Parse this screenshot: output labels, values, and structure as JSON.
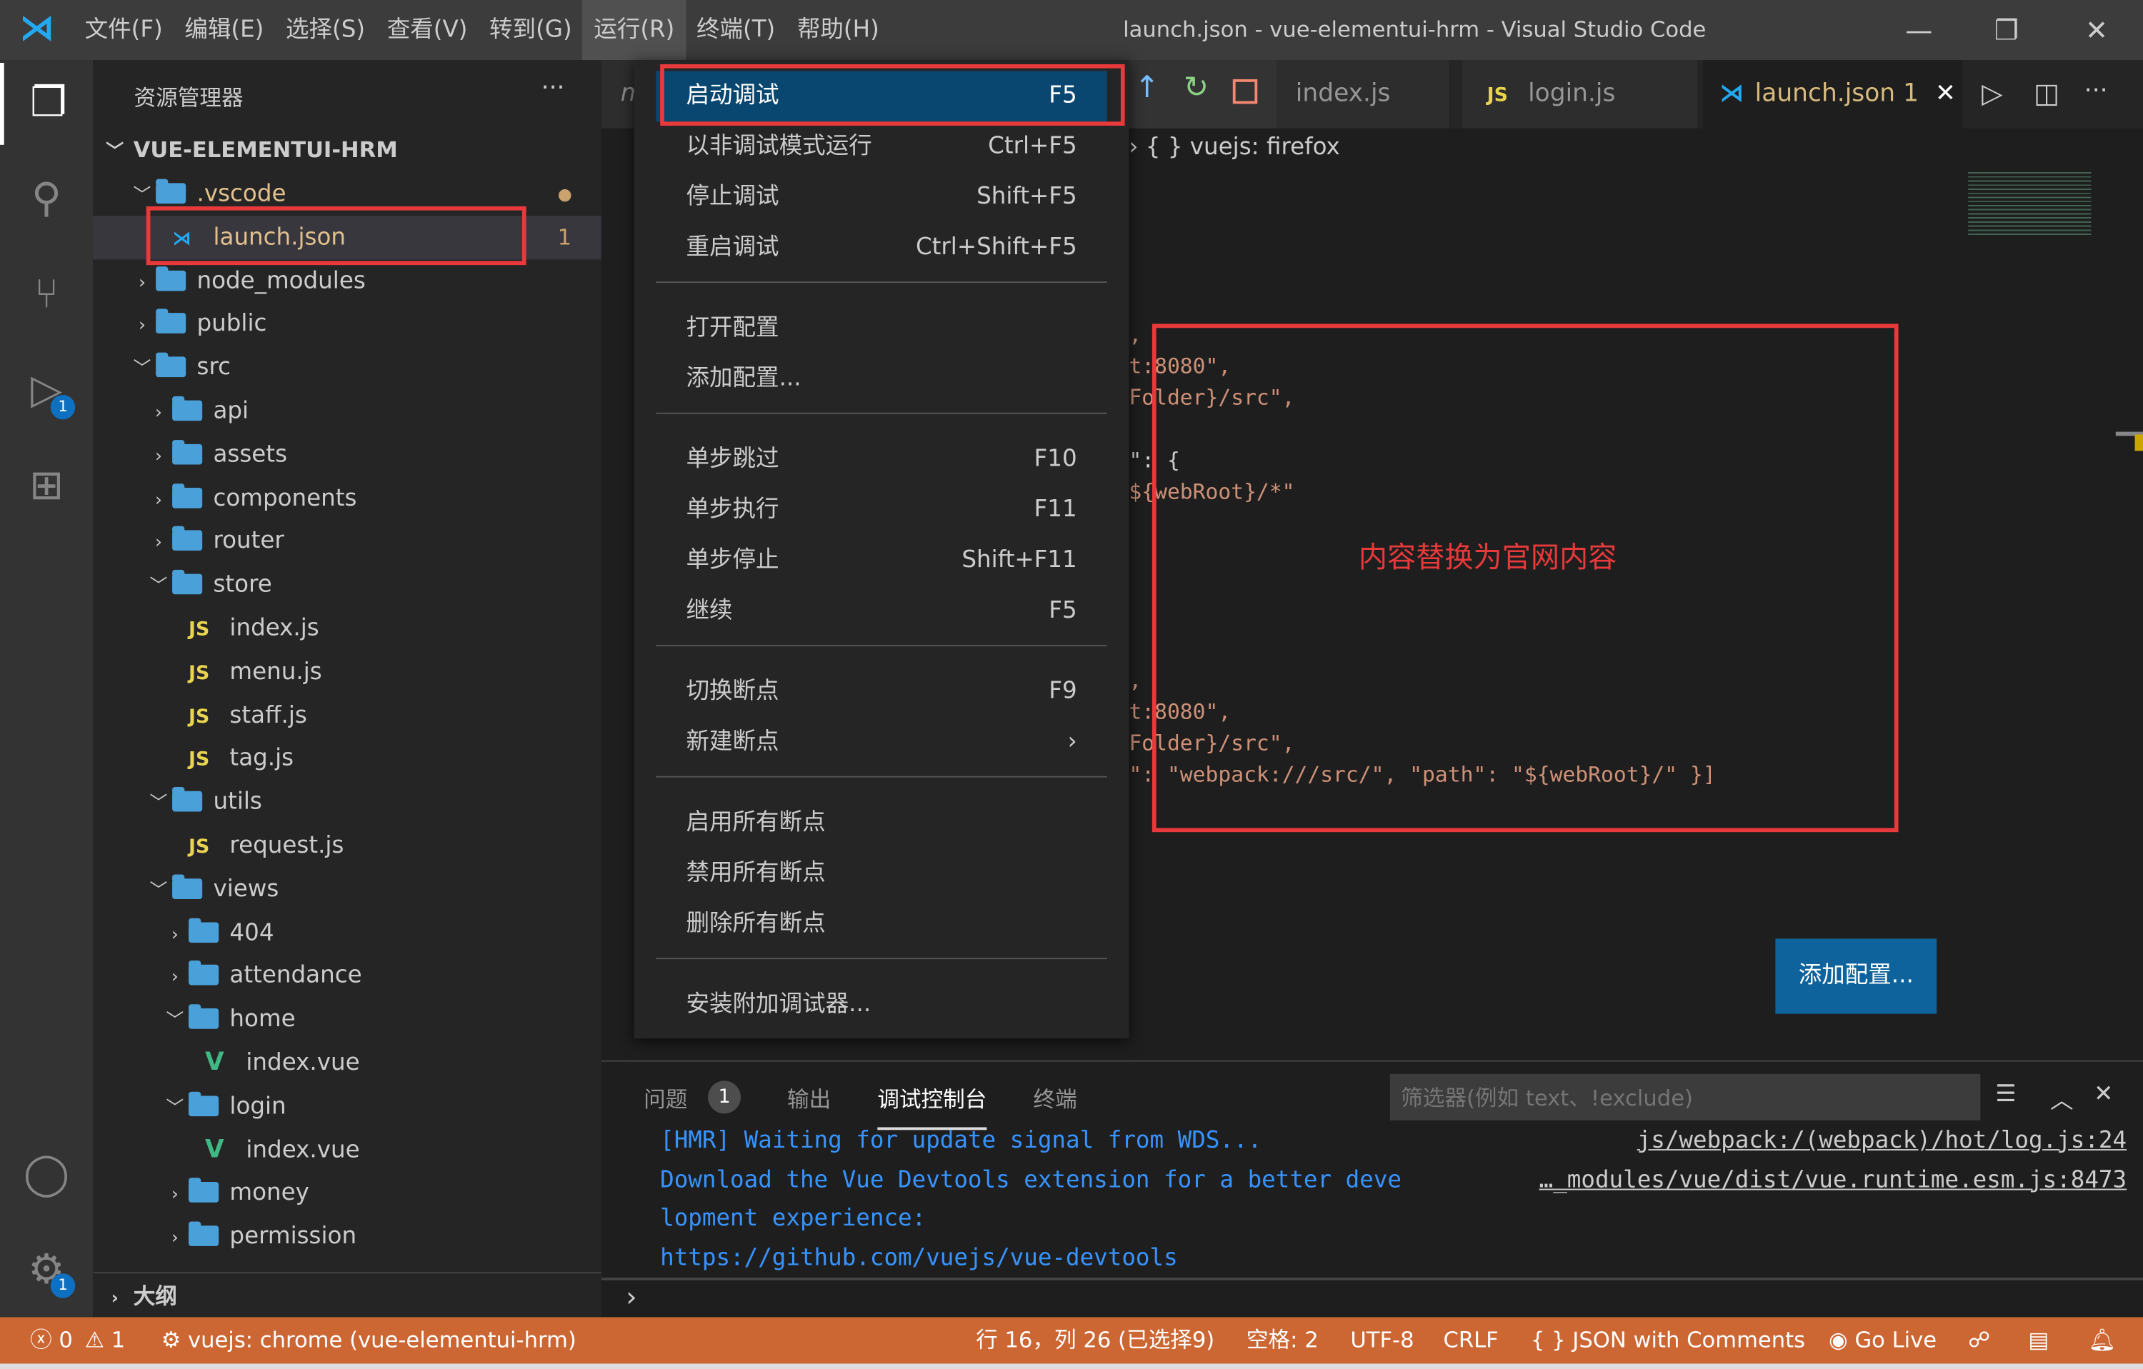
{
  "titlebar": {
    "menus": [
      "文件(F)",
      "编辑(E)",
      "选择(S)",
      "查看(V)",
      "转到(G)",
      "运行(R)",
      "终端(T)",
      "帮助(H)"
    ],
    "title": "launch.json - vue-elementui-hrm - Visual Studio Code"
  },
  "sidebar": {
    "title": "资源管理器",
    "more": "···",
    "project": "VUE-ELEMENTUI-HRM",
    "tree": [
      {
        "label": ".vscode",
        "type": "folder",
        "level": 1,
        "open": true,
        "color": "#e2c08d",
        "mark": "●"
      },
      {
        "label": "launch.json",
        "type": "vscode",
        "level": 2,
        "color": "#e2c08d",
        "mark": "1",
        "selected": true
      },
      {
        "label": "node_modules",
        "type": "folder",
        "level": 1,
        "open": false
      },
      {
        "label": "public",
        "type": "folder",
        "level": 1,
        "open": false
      },
      {
        "label": "src",
        "type": "folder",
        "level": 1,
        "open": true
      },
      {
        "label": "api",
        "type": "folder",
        "level": 2,
        "open": false
      },
      {
        "label": "assets",
        "type": "folder",
        "level": 2,
        "open": false
      },
      {
        "label": "components",
        "type": "folder",
        "level": 2,
        "open": false
      },
      {
        "label": "router",
        "type": "folder",
        "level": 2,
        "open": false
      },
      {
        "label": "store",
        "type": "folder",
        "level": 2,
        "open": true
      },
      {
        "label": "index.js",
        "type": "js",
        "level": 3
      },
      {
        "label": "menu.js",
        "type": "js",
        "level": 3
      },
      {
        "label": "staff.js",
        "type": "js",
        "level": 3
      },
      {
        "label": "tag.js",
        "type": "js",
        "level": 3
      },
      {
        "label": "utils",
        "type": "folder",
        "level": 2,
        "open": true
      },
      {
        "label": "request.js",
        "type": "js",
        "level": 3
      },
      {
        "label": "views",
        "type": "folder",
        "level": 2,
        "open": true
      },
      {
        "label": "404",
        "type": "folder",
        "level": 3,
        "open": false
      },
      {
        "label": "attendance",
        "type": "folder",
        "level": 3,
        "open": false
      },
      {
        "label": "home",
        "type": "folder",
        "level": 3,
        "open": true
      },
      {
        "label": "index.vue",
        "type": "vue",
        "level": 4
      },
      {
        "label": "login",
        "type": "folder",
        "level": 3,
        "open": true
      },
      {
        "label": "index.vue",
        "type": "vue",
        "level": 4
      },
      {
        "label": "money",
        "type": "folder",
        "level": 3,
        "open": false
      },
      {
        "label": "permission",
        "type": "folder",
        "level": 3,
        "open": false
      }
    ],
    "outline": "大纲"
  },
  "activity": {
    "debug_badge": "1",
    "settings_badge": "1"
  },
  "tabs": [
    {
      "label": "index.js",
      "icon": "js"
    },
    {
      "label": "login.js",
      "icon": "js"
    },
    {
      "label": "launch.json 1",
      "icon": "vscode",
      "active": true
    }
  ],
  "debug_toolbar": [
    "step-into",
    "restart",
    "stop"
  ],
  "breadcrumb": "{ } vuejs: firefox",
  "run_menu": {
    "groups": [
      [
        {
          "label": "启动调试",
          "key": "F5",
          "selected": true
        },
        {
          "label": "以非调试模式运行",
          "key": "Ctrl+F5"
        },
        {
          "label": "停止调试",
          "key": "Shift+F5"
        },
        {
          "label": "重启调试",
          "key": "Ctrl+Shift+F5"
        }
      ],
      [
        {
          "label": "打开配置",
          "key": ""
        },
        {
          "label": "添加配置...",
          "key": ""
        }
      ],
      [
        {
          "label": "单步跳过",
          "key": "F10"
        },
        {
          "label": "单步执行",
          "key": "F11"
        },
        {
          "label": "单步停止",
          "key": "Shift+F11"
        },
        {
          "label": "继续",
          "key": "F5"
        }
      ],
      [
        {
          "label": "切换断点",
          "key": "F9"
        },
        {
          "label": "新建断点",
          "key": "›"
        }
      ],
      [
        {
          "label": "启用所有断点",
          "key": ""
        },
        {
          "label": "禁用所有断点",
          "key": ""
        },
        {
          "label": "删除所有断点",
          "key": ""
        }
      ],
      [
        {
          "label": "安装附加调试器...",
          "key": ""
        }
      ]
    ]
  },
  "editor": {
    "code": [
      ",",
      "t:8080\",",
      "Folder}/src\",",
      "",
      "\": {",
      "${webRoot}/*\"",
      "",
      "",
      "",
      "",
      "",
      ",",
      "t:8080\",",
      "Folder}/src\",",
      "\": \"webpack:///src/\", \"path\": \"${webRoot}/\" }]"
    ],
    "annotation": "内容替换为官网内容",
    "add_config": "添加配置...",
    "annotation_color": "#e8393b"
  },
  "panel": {
    "tabs": [
      "问题",
      "输出",
      "调试控制台",
      "终端"
    ],
    "problems_count": "1",
    "filter_placeholder": "筛选器(例如 text、!exclude)",
    "lines": [
      {
        "text": "[HMR] Waiting for update signal from WDS...",
        "source": "js/webpack:/(webpack)/hot/log.js:24"
      },
      {
        "text": "Download the Vue Devtools extension for a better deve",
        "source": "…_modules/vue/dist/vue.runtime.esm.js:8473"
      },
      {
        "text": "lopment experience:",
        "source": ""
      },
      {
        "text": "https://github.com/vuejs/vue-devtools",
        "source": ""
      }
    ],
    "prompt": "›"
  },
  "status": {
    "errors": "ⓧ 0",
    "warnings": "⚠ 1",
    "debug": "vuejs: chrome (vue-elementui-hrm)",
    "position": "行 16，列 26 (已选择9)",
    "spaces": "空格: 2",
    "encoding": "UTF-8",
    "eol": "CRLF",
    "language": "{ } JSON with Comments",
    "golive": "Go Live",
    "color": "#cc6633"
  }
}
